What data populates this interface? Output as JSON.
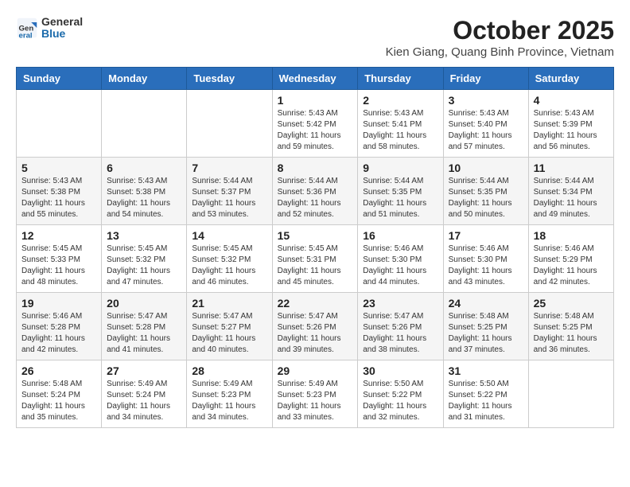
{
  "header": {
    "logo_general": "General",
    "logo_blue": "Blue",
    "month_title": "October 2025",
    "subtitle": "Kien Giang, Quang Binh Province, Vietnam"
  },
  "days_of_week": [
    "Sunday",
    "Monday",
    "Tuesday",
    "Wednesday",
    "Thursday",
    "Friday",
    "Saturday"
  ],
  "weeks": [
    [
      {
        "day": "",
        "info": ""
      },
      {
        "day": "",
        "info": ""
      },
      {
        "day": "",
        "info": ""
      },
      {
        "day": "1",
        "info": "Sunrise: 5:43 AM\nSunset: 5:42 PM\nDaylight: 11 hours\nand 59 minutes."
      },
      {
        "day": "2",
        "info": "Sunrise: 5:43 AM\nSunset: 5:41 PM\nDaylight: 11 hours\nand 58 minutes."
      },
      {
        "day": "3",
        "info": "Sunrise: 5:43 AM\nSunset: 5:40 PM\nDaylight: 11 hours\nand 57 minutes."
      },
      {
        "day": "4",
        "info": "Sunrise: 5:43 AM\nSunset: 5:39 PM\nDaylight: 11 hours\nand 56 minutes."
      }
    ],
    [
      {
        "day": "5",
        "info": "Sunrise: 5:43 AM\nSunset: 5:38 PM\nDaylight: 11 hours\nand 55 minutes."
      },
      {
        "day": "6",
        "info": "Sunrise: 5:43 AM\nSunset: 5:38 PM\nDaylight: 11 hours\nand 54 minutes."
      },
      {
        "day": "7",
        "info": "Sunrise: 5:44 AM\nSunset: 5:37 PM\nDaylight: 11 hours\nand 53 minutes."
      },
      {
        "day": "8",
        "info": "Sunrise: 5:44 AM\nSunset: 5:36 PM\nDaylight: 11 hours\nand 52 minutes."
      },
      {
        "day": "9",
        "info": "Sunrise: 5:44 AM\nSunset: 5:35 PM\nDaylight: 11 hours\nand 51 minutes."
      },
      {
        "day": "10",
        "info": "Sunrise: 5:44 AM\nSunset: 5:35 PM\nDaylight: 11 hours\nand 50 minutes."
      },
      {
        "day": "11",
        "info": "Sunrise: 5:44 AM\nSunset: 5:34 PM\nDaylight: 11 hours\nand 49 minutes."
      }
    ],
    [
      {
        "day": "12",
        "info": "Sunrise: 5:45 AM\nSunset: 5:33 PM\nDaylight: 11 hours\nand 48 minutes."
      },
      {
        "day": "13",
        "info": "Sunrise: 5:45 AM\nSunset: 5:32 PM\nDaylight: 11 hours\nand 47 minutes."
      },
      {
        "day": "14",
        "info": "Sunrise: 5:45 AM\nSunset: 5:32 PM\nDaylight: 11 hours\nand 46 minutes."
      },
      {
        "day": "15",
        "info": "Sunrise: 5:45 AM\nSunset: 5:31 PM\nDaylight: 11 hours\nand 45 minutes."
      },
      {
        "day": "16",
        "info": "Sunrise: 5:46 AM\nSunset: 5:30 PM\nDaylight: 11 hours\nand 44 minutes."
      },
      {
        "day": "17",
        "info": "Sunrise: 5:46 AM\nSunset: 5:30 PM\nDaylight: 11 hours\nand 43 minutes."
      },
      {
        "day": "18",
        "info": "Sunrise: 5:46 AM\nSunset: 5:29 PM\nDaylight: 11 hours\nand 42 minutes."
      }
    ],
    [
      {
        "day": "19",
        "info": "Sunrise: 5:46 AM\nSunset: 5:28 PM\nDaylight: 11 hours\nand 42 minutes."
      },
      {
        "day": "20",
        "info": "Sunrise: 5:47 AM\nSunset: 5:28 PM\nDaylight: 11 hours\nand 41 minutes."
      },
      {
        "day": "21",
        "info": "Sunrise: 5:47 AM\nSunset: 5:27 PM\nDaylight: 11 hours\nand 40 minutes."
      },
      {
        "day": "22",
        "info": "Sunrise: 5:47 AM\nSunset: 5:26 PM\nDaylight: 11 hours\nand 39 minutes."
      },
      {
        "day": "23",
        "info": "Sunrise: 5:47 AM\nSunset: 5:26 PM\nDaylight: 11 hours\nand 38 minutes."
      },
      {
        "day": "24",
        "info": "Sunrise: 5:48 AM\nSunset: 5:25 PM\nDaylight: 11 hours\nand 37 minutes."
      },
      {
        "day": "25",
        "info": "Sunrise: 5:48 AM\nSunset: 5:25 PM\nDaylight: 11 hours\nand 36 minutes."
      }
    ],
    [
      {
        "day": "26",
        "info": "Sunrise: 5:48 AM\nSunset: 5:24 PM\nDaylight: 11 hours\nand 35 minutes."
      },
      {
        "day": "27",
        "info": "Sunrise: 5:49 AM\nSunset: 5:24 PM\nDaylight: 11 hours\nand 34 minutes."
      },
      {
        "day": "28",
        "info": "Sunrise: 5:49 AM\nSunset: 5:23 PM\nDaylight: 11 hours\nand 34 minutes."
      },
      {
        "day": "29",
        "info": "Sunrise: 5:49 AM\nSunset: 5:23 PM\nDaylight: 11 hours\nand 33 minutes."
      },
      {
        "day": "30",
        "info": "Sunrise: 5:50 AM\nSunset: 5:22 PM\nDaylight: 11 hours\nand 32 minutes."
      },
      {
        "day": "31",
        "info": "Sunrise: 5:50 AM\nSunset: 5:22 PM\nDaylight: 11 hours\nand 31 minutes."
      },
      {
        "day": "",
        "info": ""
      }
    ]
  ]
}
